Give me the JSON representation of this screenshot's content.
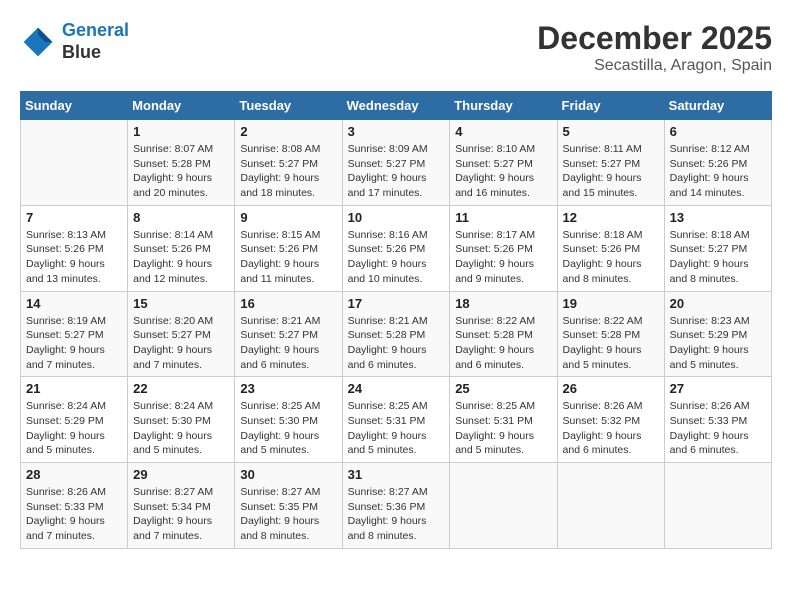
{
  "header": {
    "logo_line1": "General",
    "logo_line2": "Blue",
    "month": "December 2025",
    "location": "Secastilla, Aragon, Spain"
  },
  "days_of_week": [
    "Sunday",
    "Monday",
    "Tuesday",
    "Wednesday",
    "Thursday",
    "Friday",
    "Saturday"
  ],
  "weeks": [
    [
      {
        "day": "",
        "info": ""
      },
      {
        "day": "1",
        "info": "Sunrise: 8:07 AM\nSunset: 5:28 PM\nDaylight: 9 hours\nand 20 minutes."
      },
      {
        "day": "2",
        "info": "Sunrise: 8:08 AM\nSunset: 5:27 PM\nDaylight: 9 hours\nand 18 minutes."
      },
      {
        "day": "3",
        "info": "Sunrise: 8:09 AM\nSunset: 5:27 PM\nDaylight: 9 hours\nand 17 minutes."
      },
      {
        "day": "4",
        "info": "Sunrise: 8:10 AM\nSunset: 5:27 PM\nDaylight: 9 hours\nand 16 minutes."
      },
      {
        "day": "5",
        "info": "Sunrise: 8:11 AM\nSunset: 5:27 PM\nDaylight: 9 hours\nand 15 minutes."
      },
      {
        "day": "6",
        "info": "Sunrise: 8:12 AM\nSunset: 5:26 PM\nDaylight: 9 hours\nand 14 minutes."
      }
    ],
    [
      {
        "day": "7",
        "info": "Sunrise: 8:13 AM\nSunset: 5:26 PM\nDaylight: 9 hours\nand 13 minutes."
      },
      {
        "day": "8",
        "info": "Sunrise: 8:14 AM\nSunset: 5:26 PM\nDaylight: 9 hours\nand 12 minutes."
      },
      {
        "day": "9",
        "info": "Sunrise: 8:15 AM\nSunset: 5:26 PM\nDaylight: 9 hours\nand 11 minutes."
      },
      {
        "day": "10",
        "info": "Sunrise: 8:16 AM\nSunset: 5:26 PM\nDaylight: 9 hours\nand 10 minutes."
      },
      {
        "day": "11",
        "info": "Sunrise: 8:17 AM\nSunset: 5:26 PM\nDaylight: 9 hours\nand 9 minutes."
      },
      {
        "day": "12",
        "info": "Sunrise: 8:18 AM\nSunset: 5:26 PM\nDaylight: 9 hours\nand 8 minutes."
      },
      {
        "day": "13",
        "info": "Sunrise: 8:18 AM\nSunset: 5:27 PM\nDaylight: 9 hours\nand 8 minutes."
      }
    ],
    [
      {
        "day": "14",
        "info": "Sunrise: 8:19 AM\nSunset: 5:27 PM\nDaylight: 9 hours\nand 7 minutes."
      },
      {
        "day": "15",
        "info": "Sunrise: 8:20 AM\nSunset: 5:27 PM\nDaylight: 9 hours\nand 7 minutes."
      },
      {
        "day": "16",
        "info": "Sunrise: 8:21 AM\nSunset: 5:27 PM\nDaylight: 9 hours\nand 6 minutes."
      },
      {
        "day": "17",
        "info": "Sunrise: 8:21 AM\nSunset: 5:28 PM\nDaylight: 9 hours\nand 6 minutes."
      },
      {
        "day": "18",
        "info": "Sunrise: 8:22 AM\nSunset: 5:28 PM\nDaylight: 9 hours\nand 6 minutes."
      },
      {
        "day": "19",
        "info": "Sunrise: 8:22 AM\nSunset: 5:28 PM\nDaylight: 9 hours\nand 5 minutes."
      },
      {
        "day": "20",
        "info": "Sunrise: 8:23 AM\nSunset: 5:29 PM\nDaylight: 9 hours\nand 5 minutes."
      }
    ],
    [
      {
        "day": "21",
        "info": "Sunrise: 8:24 AM\nSunset: 5:29 PM\nDaylight: 9 hours\nand 5 minutes."
      },
      {
        "day": "22",
        "info": "Sunrise: 8:24 AM\nSunset: 5:30 PM\nDaylight: 9 hours\nand 5 minutes."
      },
      {
        "day": "23",
        "info": "Sunrise: 8:25 AM\nSunset: 5:30 PM\nDaylight: 9 hours\nand 5 minutes."
      },
      {
        "day": "24",
        "info": "Sunrise: 8:25 AM\nSunset: 5:31 PM\nDaylight: 9 hours\nand 5 minutes."
      },
      {
        "day": "25",
        "info": "Sunrise: 8:25 AM\nSunset: 5:31 PM\nDaylight: 9 hours\nand 5 minutes."
      },
      {
        "day": "26",
        "info": "Sunrise: 8:26 AM\nSunset: 5:32 PM\nDaylight: 9 hours\nand 6 minutes."
      },
      {
        "day": "27",
        "info": "Sunrise: 8:26 AM\nSunset: 5:33 PM\nDaylight: 9 hours\nand 6 minutes."
      }
    ],
    [
      {
        "day": "28",
        "info": "Sunrise: 8:26 AM\nSunset: 5:33 PM\nDaylight: 9 hours\nand 7 minutes."
      },
      {
        "day": "29",
        "info": "Sunrise: 8:27 AM\nSunset: 5:34 PM\nDaylight: 9 hours\nand 7 minutes."
      },
      {
        "day": "30",
        "info": "Sunrise: 8:27 AM\nSunset: 5:35 PM\nDaylight: 9 hours\nand 8 minutes."
      },
      {
        "day": "31",
        "info": "Sunrise: 8:27 AM\nSunset: 5:36 PM\nDaylight: 9 hours\nand 8 minutes."
      },
      {
        "day": "",
        "info": ""
      },
      {
        "day": "",
        "info": ""
      },
      {
        "day": "",
        "info": ""
      }
    ]
  ]
}
